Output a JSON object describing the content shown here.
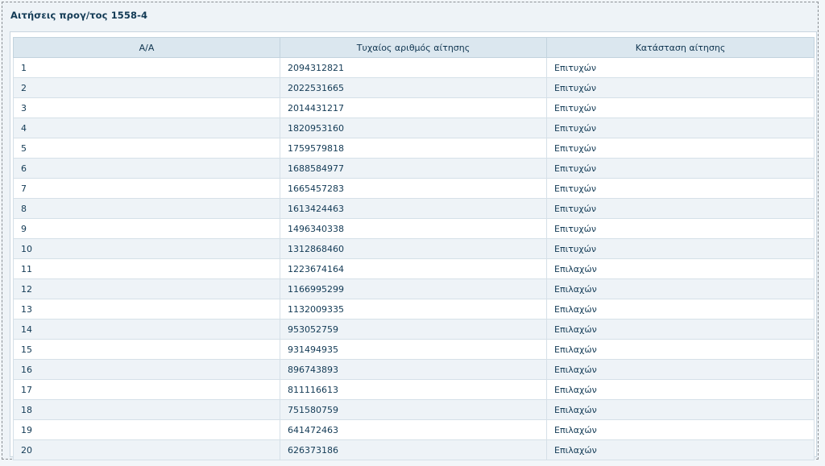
{
  "panel": {
    "title": "Αιτήσεις προγ/τος 1558-4"
  },
  "table": {
    "headers": [
      "Α/Α",
      "Τυχαίος αριθμός αίτησης",
      "Κατάσταση αίτησης"
    ],
    "rows": [
      [
        "1",
        "2094312821",
        "Επιτυχών"
      ],
      [
        "2",
        "2022531665",
        "Επιτυχών"
      ],
      [
        "3",
        "2014431217",
        "Επιτυχών"
      ],
      [
        "4",
        "1820953160",
        "Επιτυχών"
      ],
      [
        "5",
        "1759579818",
        "Επιτυχών"
      ],
      [
        "6",
        "1688584977",
        "Επιτυχών"
      ],
      [
        "7",
        "1665457283",
        "Επιτυχών"
      ],
      [
        "8",
        "1613424463",
        "Επιτυχών"
      ],
      [
        "9",
        "1496340338",
        "Επιτυχών"
      ],
      [
        "10",
        "1312868460",
        "Επιτυχών"
      ],
      [
        "11",
        "1223674164",
        "Επιλαχών"
      ],
      [
        "12",
        "1166995299",
        "Επιλαχών"
      ],
      [
        "13",
        "1132009335",
        "Επιλαχών"
      ],
      [
        "14",
        "953052759",
        "Επιλαχών"
      ],
      [
        "15",
        "931494935",
        "Επιλαχών"
      ],
      [
        "16",
        "896743893",
        "Επιλαχών"
      ],
      [
        "17",
        "811116613",
        "Επιλαχών"
      ],
      [
        "18",
        "751580759",
        "Επιλαχών"
      ],
      [
        "19",
        "641472463",
        "Επιλαχών"
      ],
      [
        "20",
        "626373186",
        "Επιλαχών"
      ]
    ]
  }
}
